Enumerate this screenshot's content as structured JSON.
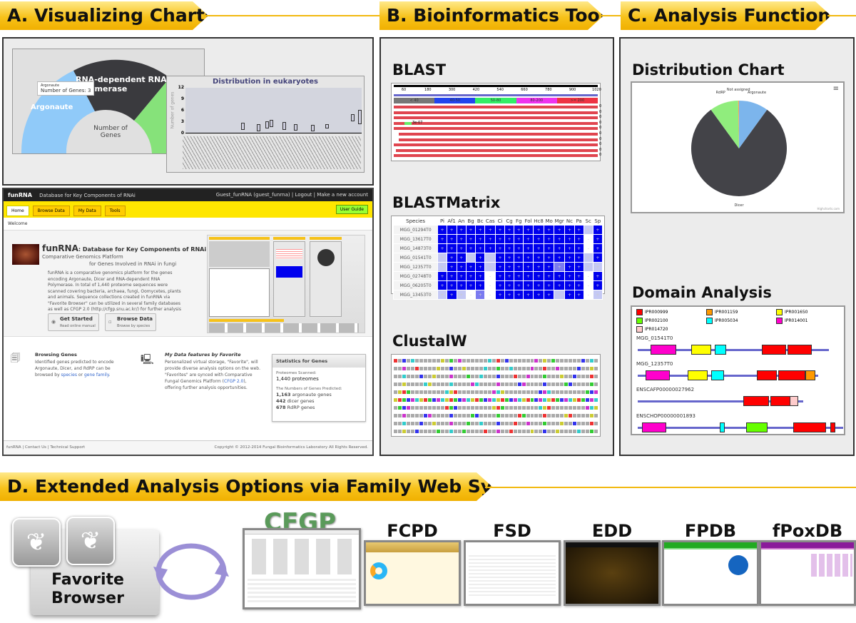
{
  "sections": {
    "a": "A. Visualizing Charts",
    "b": "B. Bioinformatics Tools",
    "c": "C. Analysis Functions",
    "d": "D. Extended Analysis Options via Family Web Systems"
  },
  "panel_a": {
    "donut": {
      "labels": [
        "RNA-dependent RNA Polymerase",
        "Argonaute"
      ],
      "center": "Number of Genes",
      "tooltip_title": "Argonaute",
      "tooltip_value": "Number of Genes: 3",
      "colors": {
        "argonaute": "#90caf9",
        "rdrp": "#3a3a3e",
        "dicer": "#86e27a"
      }
    },
    "boxplot": {
      "title": "Distribution in eukaryotes",
      "ylabel": "Number of genes",
      "yticks": [
        "12",
        "9",
        "6",
        "3",
        "0"
      ]
    }
  },
  "funrna": {
    "topbar": {
      "brand": "funRNA",
      "subtitle": "Database for Key Components of RNAi",
      "user": "Guest_funRNA (guest_funrna)",
      "logout": "Logout",
      "new_account": "Make a new account"
    },
    "tabs": [
      "Home",
      "Browse Data",
      "My Data",
      "Tools"
    ],
    "user_guide": "User Guide",
    "breadcrumb": "Welcome",
    "hero": {
      "title": "funRNA",
      "title_rest": ": Database for Key Components of RNAi",
      "line2": "Comparative Genomics Platform",
      "line3": "for Genes Involved in RNAi in fungi",
      "desc": "funRNA is a comparative genomics platform for the genes encoding Argonaute, Dicer and RNA-dependent RNA Polymerase. In total of 1,440 proteome sequences were scanned covering bacteria, archaea, fungi, Oomycetes, plants and animals. Sequence collections created in funRNA via \"Favorite Browser\" can be utilized in several family databases as well as CFGP 2.0 (http://cfgp.snu.ac.kr/) for further analysis options."
    },
    "buttons": [
      {
        "label": "Get Started",
        "sub": "Read online manual"
      },
      {
        "label": "Browse Data",
        "sub": "Browse by species"
      }
    ],
    "browsing": {
      "title": "Browsing Genes",
      "text": "Identified genes predicted to encode Argonaute, Dicer, and RdRP can be browsed by",
      "link1": "species",
      "or": "or",
      "link2": "gene family",
      "end": "."
    },
    "mydata": {
      "title": "My Data features by Favorite",
      "text": "Personalized virtual storage, \"Favorite\", will provide diverse analysis options on the web. \"Favorites\" are synced with Comparative Fungal Genomics Platform (",
      "link": "CFGP 2.0",
      "end": "), offering further analysis opportunities."
    },
    "stats": {
      "title": "Statistics for Genes",
      "scanned_label": "Proteomes Scanned:",
      "scanned": "1,440 proteomes",
      "predicted_label": "The Numbers of Genes Predicted:",
      "rows": [
        {
          "n": "1,163",
          "t": "argonaute genes"
        },
        {
          "n": "442",
          "t": "dicer genes"
        },
        {
          "n": "678",
          "t": "RdRP genes"
        }
      ]
    },
    "footer": {
      "links": [
        "funRNA",
        "Contact Us",
        "Technical Support"
      ],
      "copyright": "Copyright © 2012-2014 Fungal Bioinformatics Laboratory All Rights Reserved."
    }
  },
  "blast": {
    "title": "BLAST",
    "ticks": [
      "60",
      "180",
      "300",
      "420",
      "540",
      "660",
      "780",
      "900",
      "1020"
    ],
    "legend": [
      {
        "label": "< 40",
        "color": "#777777"
      },
      {
        "label": "40-50",
        "color": "#2244ee"
      },
      {
        "label": "50-80",
        "color": "#33ee66"
      },
      {
        "label": "80-200",
        "color": "#ee33ee"
      },
      {
        "label": ">= 200",
        "color": "#ee3344"
      }
    ],
    "hit_label": "3e-07",
    "scores": [
      "0",
      "0",
      "0",
      "0",
      "0",
      "0",
      "0",
      "0",
      "0",
      "0"
    ]
  },
  "blastmatrix": {
    "title": "BLASTMatrix",
    "header": "Species",
    "columns": [
      "Pi",
      "Af1",
      "An",
      "Bg",
      "Bc",
      "Cas",
      "Ci",
      "Cg",
      "Fg",
      "Fol",
      "Hc8",
      "Mo",
      "Mgr",
      "Nc",
      "Pa",
      "Sc",
      "Sp"
    ],
    "rows": [
      {
        "name": "MGG_01294T0",
        "cells": "DDDDDDDDDDDDDDDLD"
      },
      {
        "name": "MGG_13617T0",
        "cells": "DDDDDDDDDDDDDDDWD"
      },
      {
        "name": "MGG_14873T0",
        "cells": "DDDDDDDDDDDDDDDWD"
      },
      {
        "name": "MGG_01541T0",
        "cells": "LDDLDLDDDDDDDDDLD"
      },
      {
        "name": "MGG_12357T0",
        "cells": "LDDDDLDDDDDDMDDLL"
      },
      {
        "name": "MGG_02748T0",
        "cells": "DDDDDWDDDDDDDDDWD"
      },
      {
        "name": "MGG_06205T0",
        "cells": "DDDDDWDDDDDDDDDWD"
      },
      {
        "name": "MGG_13453T0",
        "cells": "LDLWMWDDDDDDLDDWL"
      }
    ],
    "colors": {
      "D": "#0000ee",
      "M": "#7a7af0",
      "L": "#c4c8f4",
      "W": "#ffffff"
    }
  },
  "clustalw": {
    "title": "ClustalW"
  },
  "panel_c": {
    "pie": {
      "title": "Distribution Chart",
      "credit": "Highcharts.com",
      "type": "pie",
      "slices": [
        {
          "label": "Argonaute",
          "value": 10,
          "color": "#7cb5ec"
        },
        {
          "label": "Dicer",
          "value": 80,
          "color": "#434348"
        },
        {
          "label": "RdRP",
          "value": 9.7,
          "color": "#90ed7d"
        },
        {
          "label": "Not assigned",
          "value": 0.3,
          "color": "#f7a35c"
        }
      ]
    },
    "domain": {
      "title": "Domain Analysis",
      "legend": [
        {
          "id": "IPR000999",
          "color": "#ff0000"
        },
        {
          "id": "IPR001159",
          "color": "#ff9900"
        },
        {
          "id": "IPR001650",
          "color": "#ffff00"
        },
        {
          "id": "IPR002100",
          "color": "#66ff00"
        },
        {
          "id": "IPR005034",
          "color": "#00ffff"
        },
        {
          "id": "IPR014001",
          "color": "#ff00cc"
        },
        {
          "id": "IPR014720",
          "color": "#ffcccc"
        }
      ],
      "proteins": [
        "MGG_01541T0",
        "MGG_12357T0",
        "ENSCAFP00000027962",
        "ENSCHOP00000001893"
      ]
    }
  },
  "panel_d": {
    "favorite": "Favorite Browser",
    "systems": [
      "CFGP",
      "FCPD",
      "FSD",
      "EDD",
      "FPDB",
      "fPoxDB"
    ]
  }
}
